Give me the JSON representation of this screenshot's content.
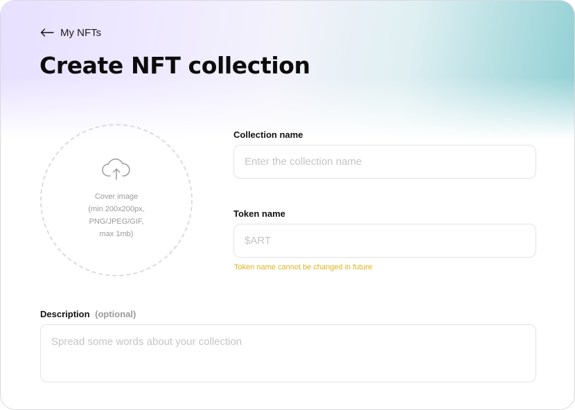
{
  "back_link": {
    "label": "My NFTs"
  },
  "page": {
    "title": "Create NFT collection"
  },
  "cover": {
    "lines": [
      "Cover image",
      "(min 200x200px,",
      "PNG/JPEG/GIF,",
      "max 1mb)"
    ]
  },
  "collection_name": {
    "label": "Collection name",
    "placeholder": "Enter the collection name",
    "value": ""
  },
  "token_name": {
    "label": "Token name",
    "placeholder": "$ART",
    "value": "",
    "hint": "Token name cannot be changed in future"
  },
  "description": {
    "label": "Description",
    "optional_tag": "(optional)",
    "placeholder": "Spread some words about your collection",
    "value": ""
  },
  "colors": {
    "hint": "#e0b21f",
    "gradient_start": "#e7e0ff",
    "gradient_end": "#8fcfd3",
    "border": "#e3e3e6"
  },
  "icons": {
    "back": "arrow-left-icon",
    "upload": "cloud-upload-icon"
  }
}
